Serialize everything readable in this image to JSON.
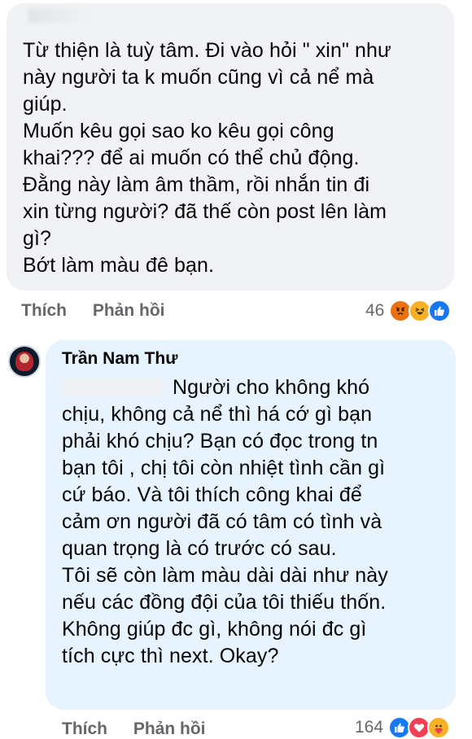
{
  "comment1": {
    "text": "Từ thiện là tuỳ tâm. Đi vào hỏi \" xin\" như\nnày người ta k muốn cũng vì cả nể mà\ngiúp.\nMuốn kêu gọi sao ko kêu gọi công\nkhai??? để ai muốn có thể chủ động.\nĐằng này làm âm thầm, rồi nhắn tin đi\nxin từng người? đã thế còn post lên làm\ngì?\nBớt làm màu đê bạn.",
    "like_label": "Thích",
    "reply_label": "Phản hồi",
    "reaction_count": "46",
    "reactions": [
      "angry-icon",
      "haha-icon",
      "like-icon"
    ]
  },
  "comment2": {
    "author": "Trần Nam Thư",
    "text_after_mention": "Người cho không khó",
    "text": "chịu, không cả nể thì há cớ gì bạn\nphải khó chịu? Bạn có đọc trong tn\nbạn tôi , chị tôi còn nhiệt tình cần gì\ncứ báo.  Và tôi thích công khai để\ncảm ơn người đã có tâm có tình và\nquan trọng là có trước có sau.\nTôi sẽ còn làm màu dài dài như này\nnếu các đồng đội của tôi thiếu thốn.\nKhông giúp đc gì, không nói đc gì\ntích cực thì next. Okay?",
    "like_label": "Thích",
    "reply_label": "Phản hồi",
    "reaction_count": "164",
    "reactions": [
      "like-icon",
      "love-icon",
      "care-icon"
    ]
  },
  "colors": {
    "bubble_gray": "#f0f2f5",
    "bubble_blue": "#e7f3ff",
    "meta_text": "#65676b",
    "like_blue": "#1877f2",
    "love_red": "#f33e58",
    "angry_orange": "#e9710f",
    "haha_yellow": "#f7b125"
  }
}
